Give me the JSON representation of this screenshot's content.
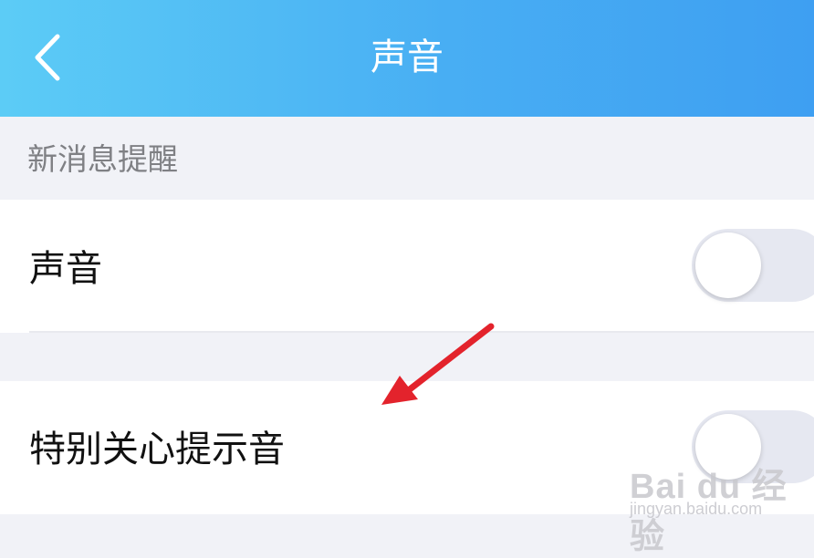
{
  "header": {
    "title": "声音",
    "back_icon": "chevron-left-icon",
    "gradient_start": "#5cccf6",
    "gradient_end": "#3e9ff2"
  },
  "section": {
    "title": "新消息提醒"
  },
  "settings": [
    {
      "label": "声音",
      "toggle_on": false
    },
    {
      "label": "特别关心提示音",
      "toggle_on": false
    }
  ],
  "annotation": {
    "arrow_color": "#e3232c",
    "arrow_icon": "red-arrow-icon"
  },
  "watermark": {
    "logo": "Bai du 经验",
    "url": "jingyan.baidu.com"
  }
}
